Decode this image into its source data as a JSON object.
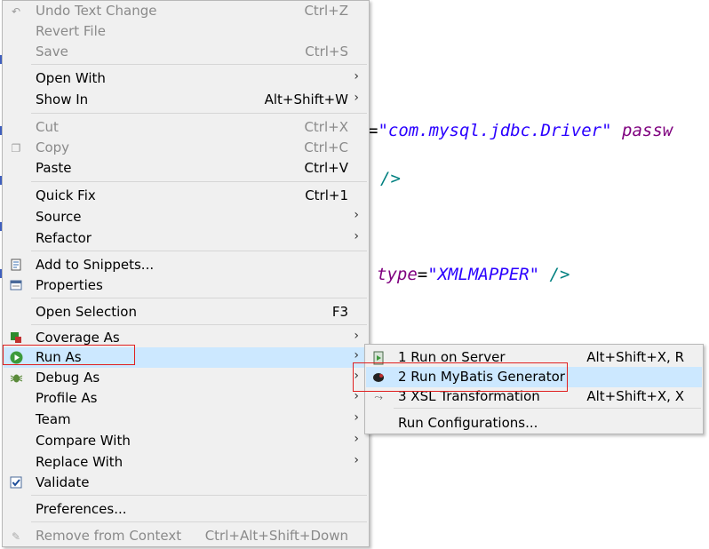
{
  "editor": {
    "line1": {
      "text1": "=",
      "string1": "\"com.mysql.jdbc.Driver\"",
      "attr": " passw"
    },
    "line2": {
      "tag": "/>"
    },
    "line3": {
      "attr": "type",
      "eq": "=",
      "string": "\"XMLMAPPER\"",
      "tag": " />"
    }
  },
  "menu": {
    "items": [
      {
        "label": "Undo Text Change",
        "accel": "Ctrl+Z",
        "disabled": true,
        "icon": "undo-icon"
      },
      {
        "label": "Revert File",
        "accel": "",
        "disabled": true
      },
      {
        "label": "Save",
        "accel": "Ctrl+S",
        "disabled": true
      },
      {
        "label": "Open With",
        "submenu": true
      },
      {
        "label": "Show In",
        "accel": "Alt+Shift+W",
        "submenu": true
      },
      {
        "label": "Cut",
        "accel": "Ctrl+X",
        "disabled": true
      },
      {
        "label": "Copy",
        "accel": "Ctrl+C",
        "disabled": true,
        "icon": "copy-icon"
      },
      {
        "label": "Paste",
        "accel": "Ctrl+V"
      },
      {
        "label": "Quick Fix",
        "accel": "Ctrl+1"
      },
      {
        "label": "Source",
        "submenu": true
      },
      {
        "label": "Refactor",
        "submenu": true
      },
      {
        "label": "Add to Snippets...",
        "icon": "snippets-icon"
      },
      {
        "label": "Properties",
        "icon": "properties-icon"
      },
      {
        "label": "Open Selection",
        "accel": "F3"
      },
      {
        "label": "Coverage As",
        "submenu": true,
        "icon": "coverage-icon"
      },
      {
        "label": "Run As",
        "submenu": true,
        "highlighted": true,
        "icon": "run-icon"
      },
      {
        "label": "Debug As",
        "submenu": true,
        "icon": "debug-icon"
      },
      {
        "label": "Profile As",
        "submenu": true
      },
      {
        "label": "Team",
        "submenu": true
      },
      {
        "label": "Compare With",
        "submenu": true
      },
      {
        "label": "Replace With",
        "submenu": true
      },
      {
        "label": "Validate",
        "icon": "check-icon"
      },
      {
        "label": "Preferences..."
      },
      {
        "label": "Remove from Context",
        "accel": "Ctrl+Alt+Shift+Down",
        "disabled": true,
        "icon": "remove-context-icon"
      }
    ]
  },
  "submenu": {
    "items": [
      {
        "label": "1 Run on Server",
        "accel": "Alt+Shift+X, R",
        "icon": "server-icon"
      },
      {
        "label": "2 Run MyBatis Generator",
        "accel": "",
        "highlighted": true,
        "icon": "mybatis-icon"
      },
      {
        "label": "3 XSL Transformation",
        "accel": "Alt+Shift+X, X",
        "icon": "xsl-icon"
      },
      {
        "label": "Run Configurations...",
        "accel": ""
      }
    ]
  },
  "arrow_glyph": "›",
  "colors": {
    "highlight": "#cce8ff",
    "annotation": "#e02020",
    "string": "#2a00ff",
    "attr": "#7f007f",
    "tag": "#008080"
  }
}
